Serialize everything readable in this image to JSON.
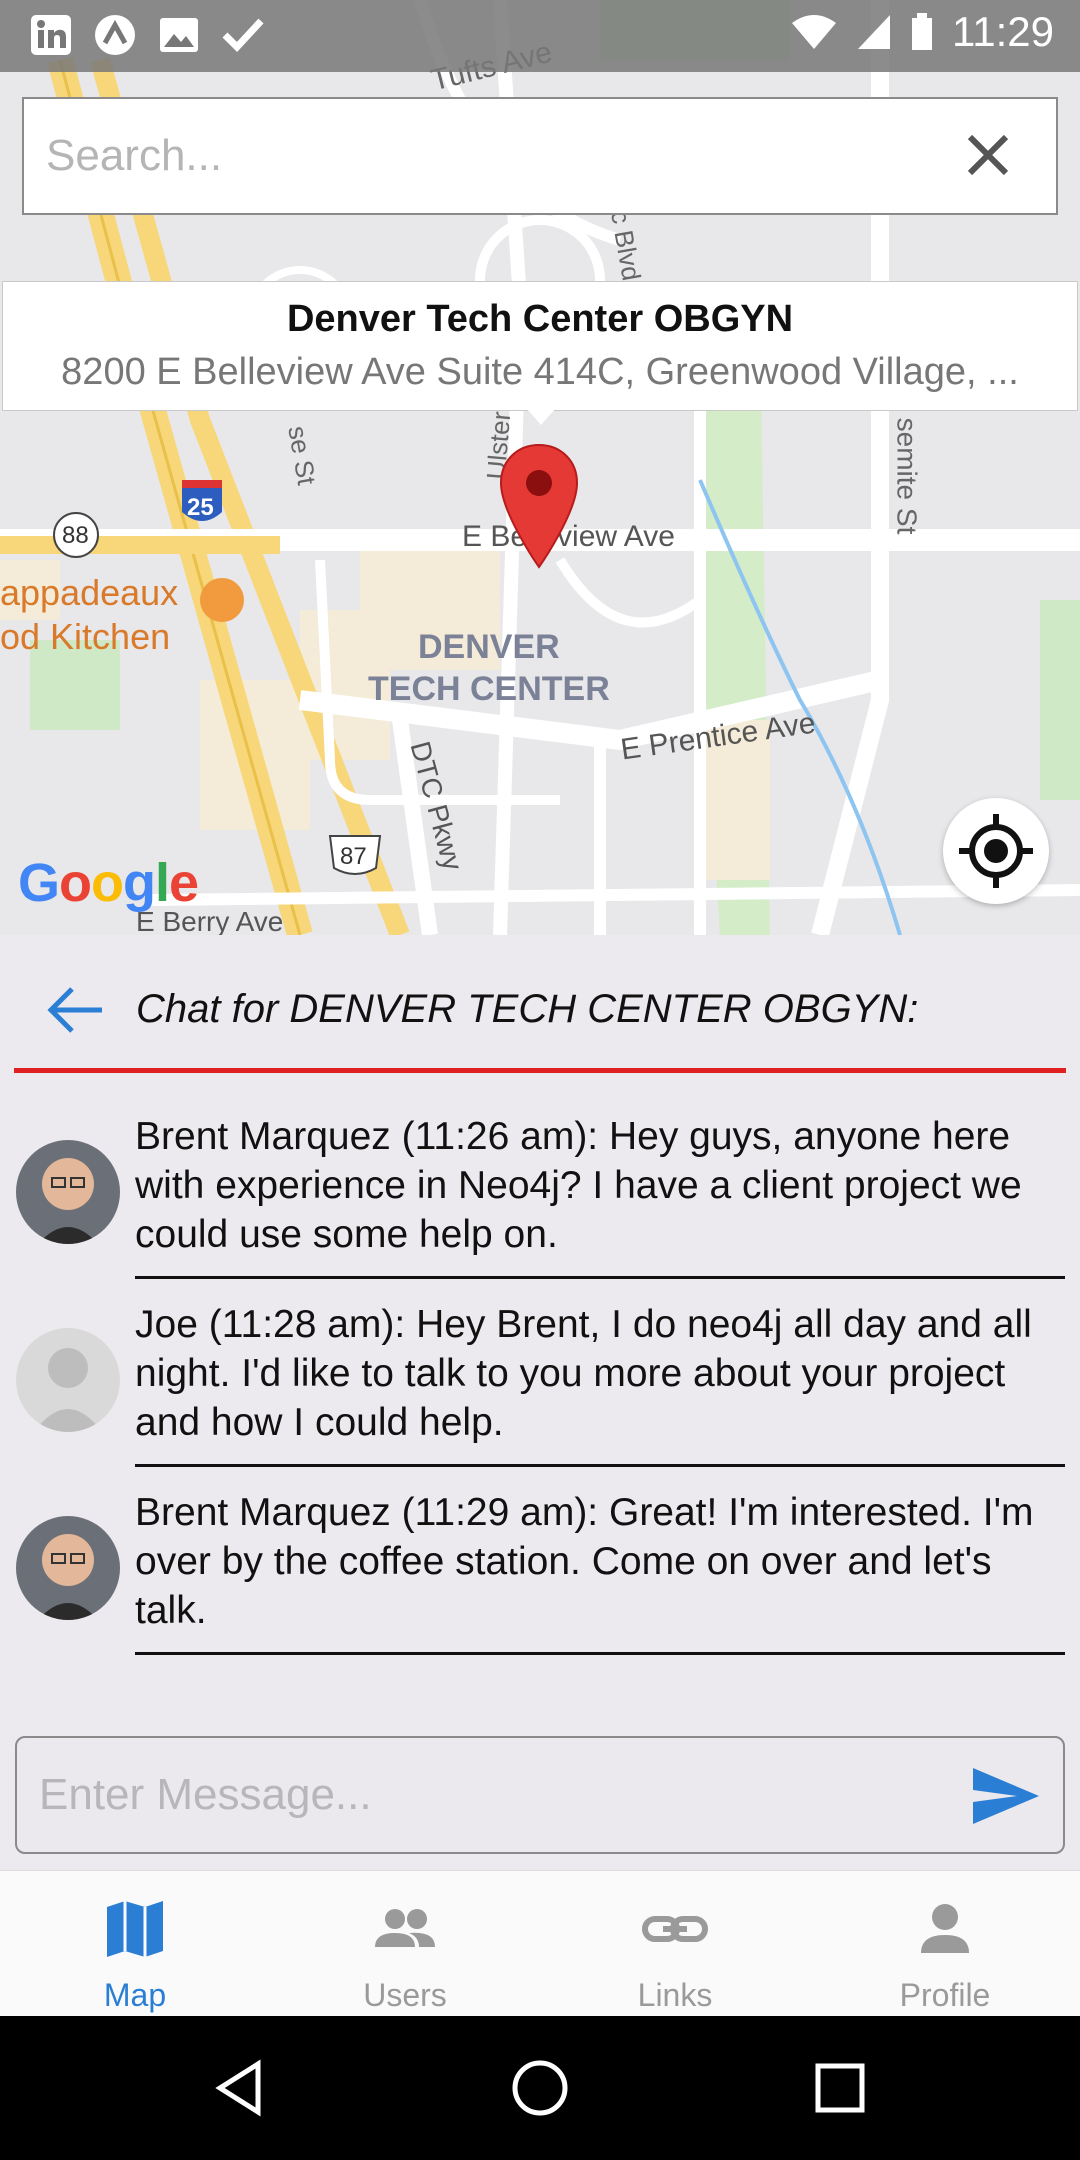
{
  "status_bar": {
    "time": "11:29",
    "icons_left": [
      "linkedin-icon",
      "app-icon",
      "image-icon",
      "check-icon"
    ],
    "icons_right": [
      "wifi-icon",
      "signal-icon",
      "battery-icon"
    ]
  },
  "map": {
    "search_placeholder": "Search...",
    "info_window": {
      "title": "Denver Tech Center OBGYN",
      "address": "8200 E Belleview Ave Suite 414C, Greenwood Village, ..."
    },
    "labels": {
      "tufts_ave": "Tufts Ave",
      "belleview": "E Belleview Ave",
      "prentice": "E Prentice Ave",
      "dtc_pkwy": "DTC Pkwy",
      "yosemite": "semite St",
      "area_line1": "DENVER",
      "area_line2": "TECH CENTER",
      "restaurant_line1": "appadeaux",
      "restaurant_line2": "od Kitchen",
      "berry": "E Berry Ave",
      "route_88": "88",
      "route_25": "25",
      "route_87": "87",
      "ulster": "Ulster",
      "blvd": "c Blvd",
      "se_st": "se St"
    },
    "google_logo": "Google"
  },
  "chat": {
    "title": "Chat for DENVER TECH CENTER OBGYN:",
    "messages": [
      {
        "text": "Brent Marquez (11:26 am): Hey guys, anyone here with experience in Neo4j?  I have a client project we could use some help on.",
        "avatar": "photo"
      },
      {
        "text": "Joe (11:28 am): Hey Brent, I do neo4j all day and all night.  I'd like to talk to you more about your project and how I could help.",
        "avatar": "placeholder"
      },
      {
        "text": "Brent Marquez (11:29 am): Great!  I'm interested. I'm over by the coffee station.  Come on over and let's talk.",
        "avatar": "photo"
      }
    ],
    "input_placeholder": "Enter Message..."
  },
  "bottom_nav": {
    "items": [
      {
        "label": "Map",
        "icon": "map-icon",
        "active": true
      },
      {
        "label": "Users",
        "icon": "users-icon",
        "active": false
      },
      {
        "label": "Links",
        "icon": "link-icon",
        "active": false
      },
      {
        "label": "Profile",
        "icon": "profile-icon",
        "active": false
      }
    ]
  },
  "colors": {
    "accent": "#2a7fd4",
    "divider": "#e02020",
    "marker": "#e53935"
  }
}
